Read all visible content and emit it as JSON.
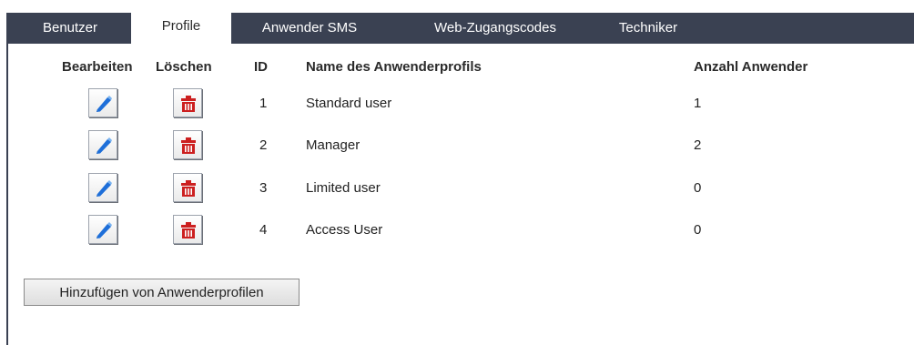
{
  "tabs": [
    {
      "label": "Benutzer",
      "active": false
    },
    {
      "label": "Profile",
      "active": true
    },
    {
      "label": "Anwender SMS",
      "active": false
    },
    {
      "label": "Web-Zugangscodes",
      "active": false
    },
    {
      "label": "Techniker",
      "active": false
    }
  ],
  "table": {
    "headers": {
      "edit": "Bearbeiten",
      "delete": "Löschen",
      "id": "ID",
      "name": "Name des Anwenderprofils",
      "count": "Anzahl Anwender"
    },
    "rows": [
      {
        "id": "1",
        "name": "Standard user",
        "count": "1"
      },
      {
        "id": "2",
        "name": "Manager",
        "count": "2"
      },
      {
        "id": "3",
        "name": "Limited user",
        "count": "0"
      },
      {
        "id": "4",
        "name": "Access User",
        "count": "0"
      }
    ]
  },
  "add_button_label": "Hinzufügen von Anwenderprofilen",
  "icons": {
    "edit": "pencil-icon",
    "delete": "trash-icon"
  },
  "colors": {
    "tabbar": "#3a4152",
    "pencil": "#1e6fd9",
    "trash": "#cc1f1f"
  }
}
